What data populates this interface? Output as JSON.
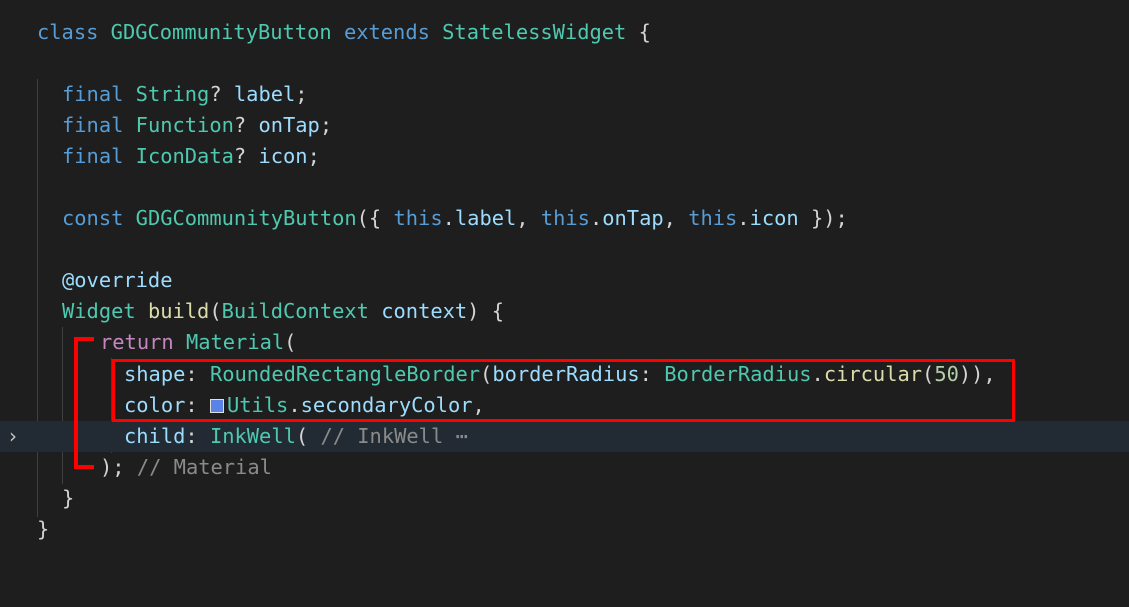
{
  "colors": {
    "highlight": "#ff0000",
    "swatch": "#5b83e6"
  },
  "code": {
    "l1": {
      "k_class": "class",
      "name": "GDGCommunityButton",
      "k_extends": "extends",
      "base": "StatelessWidget",
      "brace": "{"
    },
    "l3": {
      "k_final": "final",
      "type": "String",
      "q": "?",
      "var": "label",
      "semi": ";"
    },
    "l4": {
      "k_final": "final",
      "type": "Function",
      "q": "?",
      "var": "onTap",
      "semi": ";"
    },
    "l5": {
      "k_final": "final",
      "type": "IconData",
      "q": "?",
      "var": "icon",
      "semi": ";"
    },
    "l7": {
      "k_const": "const",
      "ctor": "GDGCommunityButton",
      "open": "({ ",
      "this1": "this",
      "dot1": ".",
      "p1": "label",
      "c1": ", ",
      "this2": "this",
      "dot2": ".",
      "p2": "onTap",
      "c2": ", ",
      "this3": "this",
      "dot3": ".",
      "p3": "icon",
      "close": " });"
    },
    "l9": {
      "annotation": "@override"
    },
    "l10": {
      "type": "Widget",
      "fn": "build",
      "open": "(",
      "ptype": "BuildContext",
      "param": "context",
      "close": ") {"
    },
    "l11": {
      "k_return": "return",
      "cls": "Material",
      "open": "("
    },
    "l12": {
      "prop": "shape",
      "colon": ": ",
      "cls": "RoundedRectangleBorder",
      "open": "(",
      "arg": "borderRadius",
      "colon2": ": ",
      "cls2": "BorderRadius",
      "dot": ".",
      "fn": "circular",
      "open2": "(",
      "num": "50",
      "close": ")),"
    },
    "l13": {
      "prop": "color",
      "colon": ": ",
      "cls": "Utils",
      "dot": ".",
      "member": "secondaryColor",
      "comma": ","
    },
    "l14": {
      "prop": "child",
      "colon": ": ",
      "cls": "InkWell",
      "open": "(",
      "comment": "// InkWell",
      "ellipsis": "⋯"
    },
    "l15": {
      "close": ");",
      "comment": "// Material"
    },
    "l16": {
      "brace": "}"
    },
    "l17": {
      "brace": "}"
    }
  }
}
